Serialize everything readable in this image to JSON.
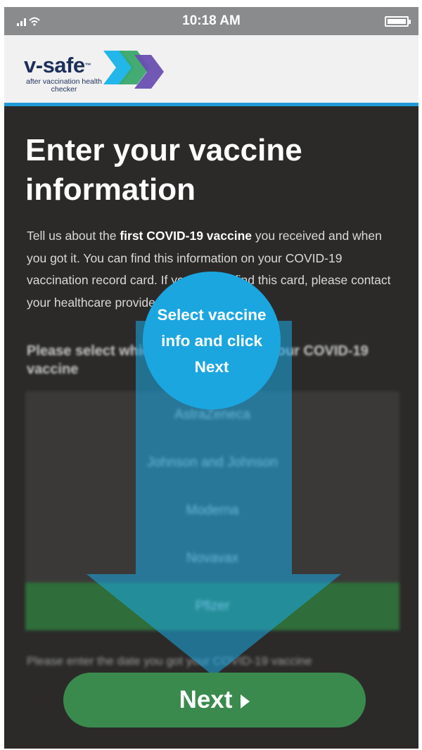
{
  "status_bar": {
    "time": "10:18 AM",
    "icons": [
      "signal-icon",
      "wifi-icon",
      "battery-icon"
    ]
  },
  "header": {
    "logo_name": "v-safe",
    "logo_tm": "™",
    "logo_tagline": "after vaccination health checker"
  },
  "page": {
    "title": "Enter your vaccine information",
    "intro_before": "Tell us about the ",
    "intro_bold": "first COVID-19 vaccine",
    "intro_after": " you received and when you got it. You can find this information on your COVID-19 vaccination record card. If you cannot find this card, please contact your healthcare provider.",
    "select_prompt": "Please select which company made your COVID-19 vaccine",
    "vaccines": [
      "AstraZeneca",
      "Johnson and Johnson",
      "Moderna",
      "Novavax",
      "Pfizer"
    ],
    "selected_vaccine": "Pfizer",
    "date_prompt": "Please enter the date you got your COVID-19 vaccine"
  },
  "overlay": {
    "hint": "Select vaccine info and click Next",
    "arrow_color": "#1ba6e0"
  },
  "next_button": {
    "label": "Next",
    "color": "#3a8a4e"
  },
  "colors": {
    "accent": "#1f9ad6",
    "background": "#2b2a29",
    "brand_navy": "#1d2f5a"
  }
}
